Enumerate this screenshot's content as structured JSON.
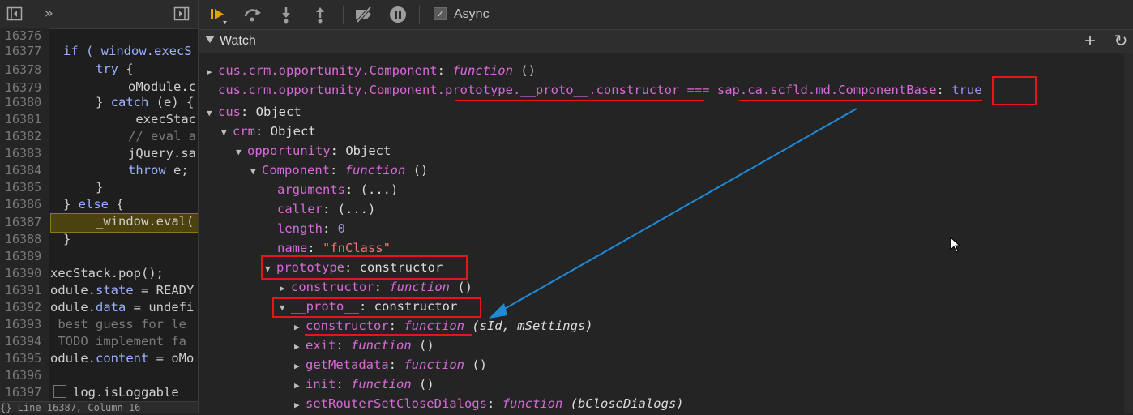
{
  "editor": {
    "line_numbers": [
      "16376",
      "16377",
      "16378",
      "16379",
      "16380",
      "16381",
      "16382",
      "16383",
      "16384",
      "16385",
      "16386",
      "16387",
      "16388",
      "16389",
      "16390",
      "16391",
      "16392",
      "16393",
      "16394",
      "16395",
      "16396",
      "16397"
    ],
    "code": {
      "l16377": "if (_window.execS",
      "l16378_kw": "try",
      "l16378_rest": " {",
      "l16379": "oModule.c",
      "l16380_a": "} ",
      "l16380_kw": "catch",
      "l16380_b": " (e) {",
      "l16381": "_execStac",
      "l16382": "// eval a",
      "l16383": "jQuery.sa",
      "l16384_kw": "throw",
      "l16384_rest": " e;",
      "l16385": "}",
      "l16386_a": "} ",
      "l16386_kw": "else",
      "l16386_b": " {",
      "l16387": "_window.eval(",
      "l16388": "}",
      "l16390": "xecStack.pop();",
      "l16391_a": "odule.",
      "l16391_p": "state",
      "l16391_b": " = READY",
      "l16392_a": "odule.",
      "l16392_p": "data",
      "l16392_b": " = undefi",
      "l16393": " best guess for le",
      "l16394": " TODO implement fa",
      "l16395_a": "odule.",
      "l16395_p": "content",
      "l16395_b": " = oMo",
      "l16397": "log.isLoggable"
    },
    "status": "{}   Line 16387, Column 16"
  },
  "toolbar": {
    "async_label": "Async",
    "async_checked": true
  },
  "watch": {
    "title": "Watch",
    "add_label": "+",
    "refresh_label": "↻",
    "expr1_name": "cus.crm.opportunity.Component",
    "expr1_sep": ": ",
    "expr1_value": "function",
    "expr1_parens": " ()",
    "expr2_name": "cus.crm.opportunity.Component.prototype.__proto__.constructor === sap.ca.scfld.md.ComponentBase",
    "expr2_sep": ": ",
    "expr2_value": "true",
    "expr3_name": "cus",
    "expr3_value": "Object"
  },
  "tree": {
    "crm": {
      "key": "crm",
      "value": "Object"
    },
    "opportunity": {
      "key": "opportunity",
      "value": "Object"
    },
    "component": {
      "key": "Component",
      "value": "function",
      "args": " ()"
    },
    "arguments": {
      "key": "arguments",
      "value": "(...)"
    },
    "caller": {
      "key": "caller",
      "value": "(...)"
    },
    "length": {
      "key": "length",
      "value": "0"
    },
    "name": {
      "key": "name",
      "value": "\"fnClass\""
    },
    "prototype": {
      "key": "prototype",
      "value": "constructor"
    },
    "proto_constructor": {
      "key": "constructor",
      "value": "function",
      "args": " ()"
    },
    "proto": {
      "key": "__proto__",
      "value": "constructor"
    },
    "p_constructor": {
      "key": "constructor",
      "value": "function",
      "args": " (sId, mSettings)"
    },
    "exit": {
      "key": "exit",
      "value": "function",
      "args": " ()"
    },
    "getMetadata": {
      "key": "getMetadata",
      "value": "function",
      "args": " ()"
    },
    "init": {
      "key": "init",
      "value": "function",
      "args": " ()"
    },
    "setRouter": {
      "key": "setRouterSetCloseDialogs",
      "value": "function",
      "args": " (bCloseDialogs)"
    }
  },
  "colors": {
    "annotation_red": "#e8141c",
    "annotation_arrow_blue": "#1f8ad8",
    "key_purple": "#d86ad8",
    "exec_line": "#4b4210"
  }
}
